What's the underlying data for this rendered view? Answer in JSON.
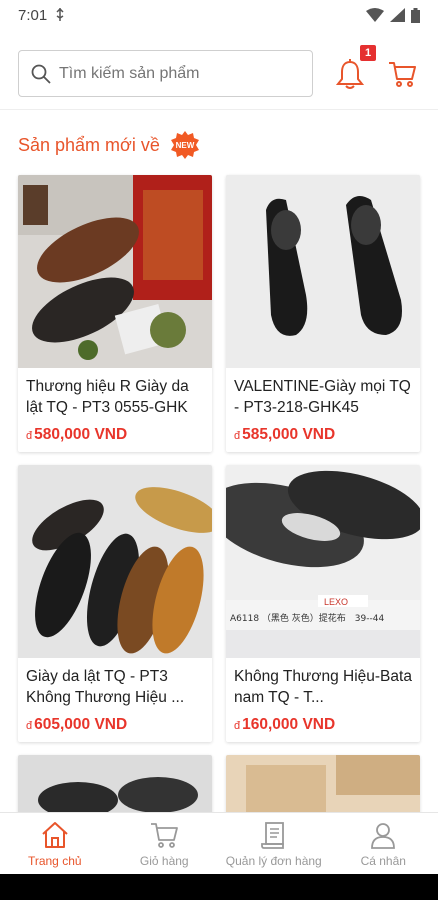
{
  "status": {
    "time": "7:01"
  },
  "search": {
    "placeholder": "Tìm kiếm sản phẩm"
  },
  "header": {
    "notification_count": "1"
  },
  "section": {
    "title": "Sản phẩm mới về",
    "badge_text": "NEW"
  },
  "products": [
    {
      "name": "Thương hiệu R Giày da lật TQ - PT3 0555-GHK",
      "price": "580,000 VND",
      "currency_symbol": "đ"
    },
    {
      "name": "VALENTINE-Giày mọi TQ - PT3-218-GHK45",
      "price": "585,000 VND",
      "currency_symbol": "đ"
    },
    {
      "name": "Giày da lật TQ - PT3 Không Thương Hiệu ...",
      "price": "605,000 VND",
      "currency_symbol": "đ"
    },
    {
      "name": "Không Thương Hiệu-Bata nam TQ - T...",
      "price": "160,000 VND",
      "currency_symbol": "đ"
    }
  ],
  "product_images": [
    {
      "label": "A6118 （黑色 灰色）提花布　39--44",
      "brand": "LEXO"
    }
  ],
  "nav": [
    {
      "label": "Trang chủ",
      "icon": "home-icon",
      "active": true
    },
    {
      "label": "Giỏ hàng",
      "icon": "cart-icon"
    },
    {
      "label": "Quản lý đơn hàng",
      "icon": "order-icon"
    },
    {
      "label": "Cá nhân",
      "icon": "user-icon"
    }
  ],
  "colors": {
    "accent": "#e8552b",
    "price": "#e8352b",
    "badge": "#e53030"
  }
}
